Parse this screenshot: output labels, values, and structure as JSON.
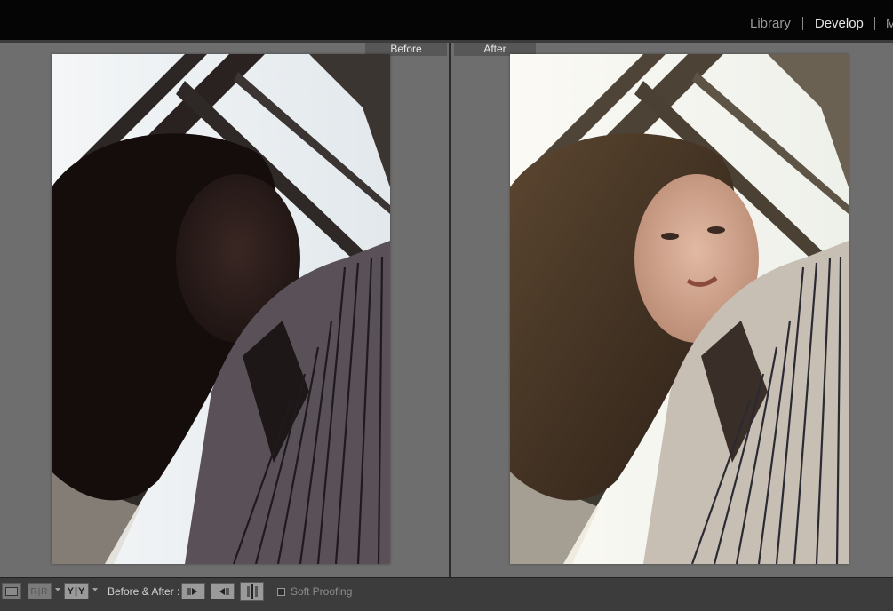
{
  "modules": {
    "library": "Library",
    "develop": "Develop",
    "map": "M"
  },
  "view": {
    "before_label": "Before",
    "after_label": "After"
  },
  "toolbar": {
    "compare_mode_glyph_left": "R|R",
    "compare_mode_glyph_right": "Y|Y",
    "before_after_label": "Before & After :",
    "soft_proofing_label": "Soft Proofing",
    "soft_proofing_checked": false
  },
  "colors": {
    "background": "#6e6e6e",
    "topbar": "#050505",
    "toolbar": "#3c3c3c",
    "active_module": "#e6e6e6",
    "inactive_module": "#9a9a9a"
  }
}
